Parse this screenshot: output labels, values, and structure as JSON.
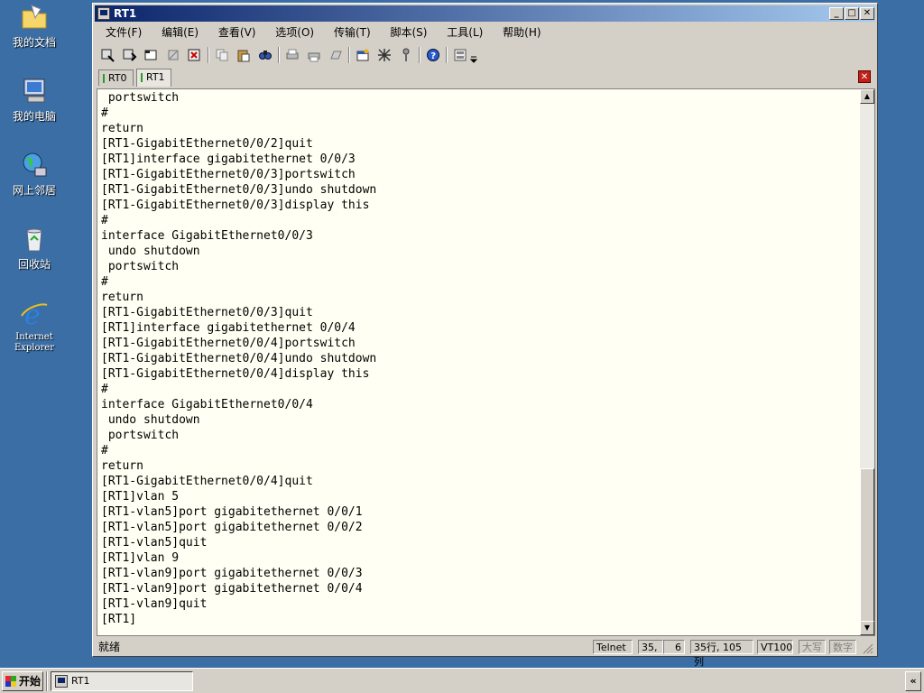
{
  "desktop": {
    "icons": [
      {
        "label": "我的文档"
      },
      {
        "label": "我的电脑"
      },
      {
        "label": "网上邻居"
      },
      {
        "label": "回收站"
      },
      {
        "label": "Internet Explorer"
      }
    ]
  },
  "window": {
    "title": "RT1",
    "controls": {
      "minimize": "_",
      "maximize": "□",
      "close": "✕"
    }
  },
  "menu": [
    {
      "label": "文件(F)"
    },
    {
      "label": "编辑(E)"
    },
    {
      "label": "查看(V)"
    },
    {
      "label": "选项(O)"
    },
    {
      "label": "传输(T)"
    },
    {
      "label": "脚本(S)"
    },
    {
      "label": "工具(L)"
    },
    {
      "label": "帮助(H)"
    }
  ],
  "toolbar": {
    "icons": [
      "connect-icon",
      "quick-connect-icon",
      "connect-tab-icon",
      "reconnect-icon",
      "disconnect-icon",
      "copy-icon",
      "paste-icon",
      "find-icon",
      "print-icon",
      "print-setup-icon",
      "print-screen-icon",
      "session-options-icon",
      "global-options-icon",
      "keymap-icon",
      "help-icon",
      "screen-options-icon"
    ]
  },
  "tabs": [
    {
      "label": "RT0",
      "active": false
    },
    {
      "label": "RT1",
      "active": true
    }
  ],
  "terminal": {
    "lines": [
      " portswitch",
      "#",
      "return",
      "[RT1-GigabitEthernet0/0/2]quit",
      "[RT1]interface gigabitethernet 0/0/3",
      "[RT1-GigabitEthernet0/0/3]portswitch",
      "[RT1-GigabitEthernet0/0/3]undo shutdown",
      "[RT1-GigabitEthernet0/0/3]display this",
      "#",
      "interface GigabitEthernet0/0/3",
      " undo shutdown",
      " portswitch",
      "#",
      "return",
      "[RT1-GigabitEthernet0/0/3]quit",
      "[RT1]interface gigabitethernet 0/0/4",
      "[RT1-GigabitEthernet0/0/4]portswitch",
      "[RT1-GigabitEthernet0/0/4]undo shutdown",
      "[RT1-GigabitEthernet0/0/4]display this",
      "#",
      "interface GigabitEthernet0/0/4",
      " undo shutdown",
      " portswitch",
      "#",
      "return",
      "[RT1-GigabitEthernet0/0/4]quit",
      "[RT1]vlan 5",
      "[RT1-vlan5]port gigabitethernet 0/0/1",
      "[RT1-vlan5]port gigabitethernet 0/0/2",
      "[RT1-vlan5]quit",
      "[RT1]vlan 9",
      "[RT1-vlan9]port gigabitethernet 0/0/3",
      "[RT1-vlan9]port gigabitethernet 0/0/4",
      "[RT1-vlan9]quit",
      "[RT1]"
    ],
    "scroll_position": 1.0
  },
  "statusbar": {
    "ready": "就绪",
    "protocol": "Telnet",
    "row": "35,",
    "col": "6",
    "size": "35行, 105列",
    "emulation": "VT100",
    "caps": "大写",
    "num": "数字"
  },
  "taskbar": {
    "start_label": "开始",
    "task_label": "RT1",
    "tray_toggle": "«"
  },
  "colors": {
    "desktop": "#3a6ea5",
    "terminal_bg": "#fffff3",
    "title_active": "#0a246a"
  }
}
